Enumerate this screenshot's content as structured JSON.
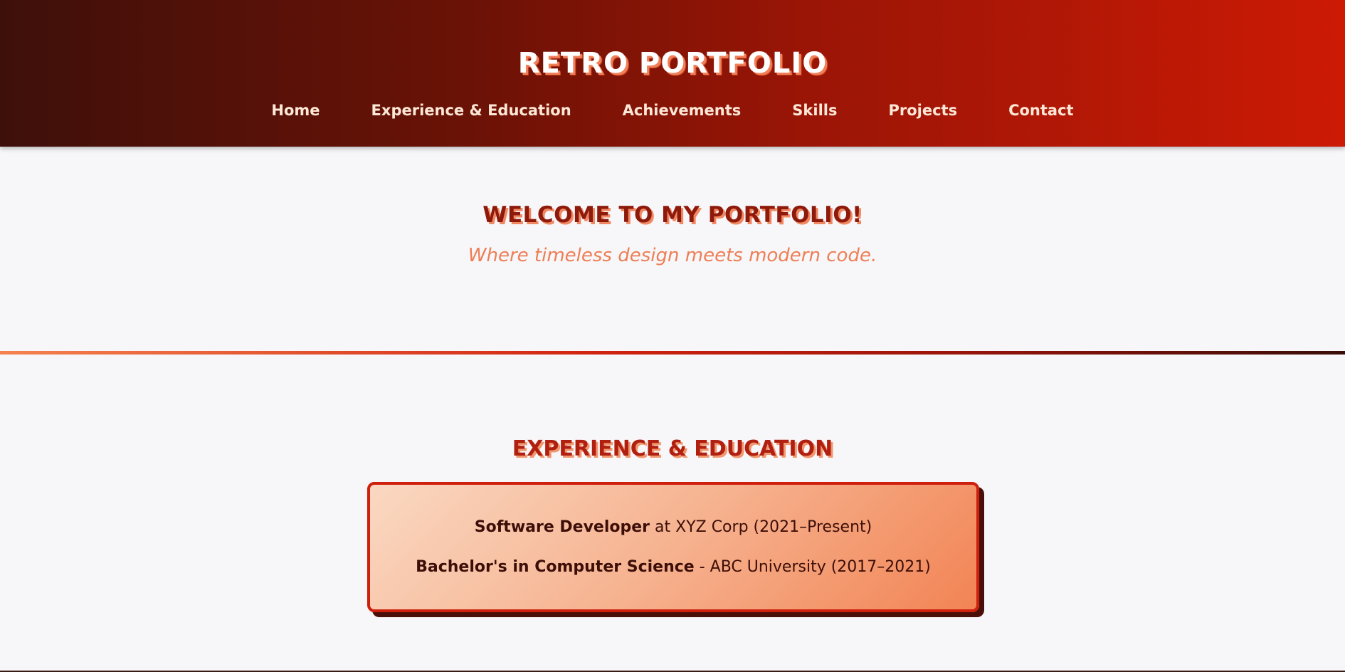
{
  "header": {
    "title": "Retro Portfolio",
    "nav": [
      {
        "label": "Home"
      },
      {
        "label": "Experience & Education"
      },
      {
        "label": "Achievements"
      },
      {
        "label": "Skills"
      },
      {
        "label": "Projects"
      },
      {
        "label": "Contact"
      }
    ]
  },
  "hero": {
    "heading": "Welcome to My Portfolio!",
    "tagline": "Where timeless design meets modern code."
  },
  "experience": {
    "heading": "Experience & Education",
    "items": [
      {
        "title": "Software Developer",
        "detail": " at XYZ Corp (2021–Present)"
      },
      {
        "title": "Bachelor's in Computer Science",
        "detail": " - ABC University (2017–2021)"
      }
    ]
  },
  "colors": {
    "header_dark": "#3e100a",
    "header_red": "#cc1a05",
    "accent_orange": "#f28455",
    "heading_red": "#8e1a0c",
    "background": "#f7f7f9"
  }
}
